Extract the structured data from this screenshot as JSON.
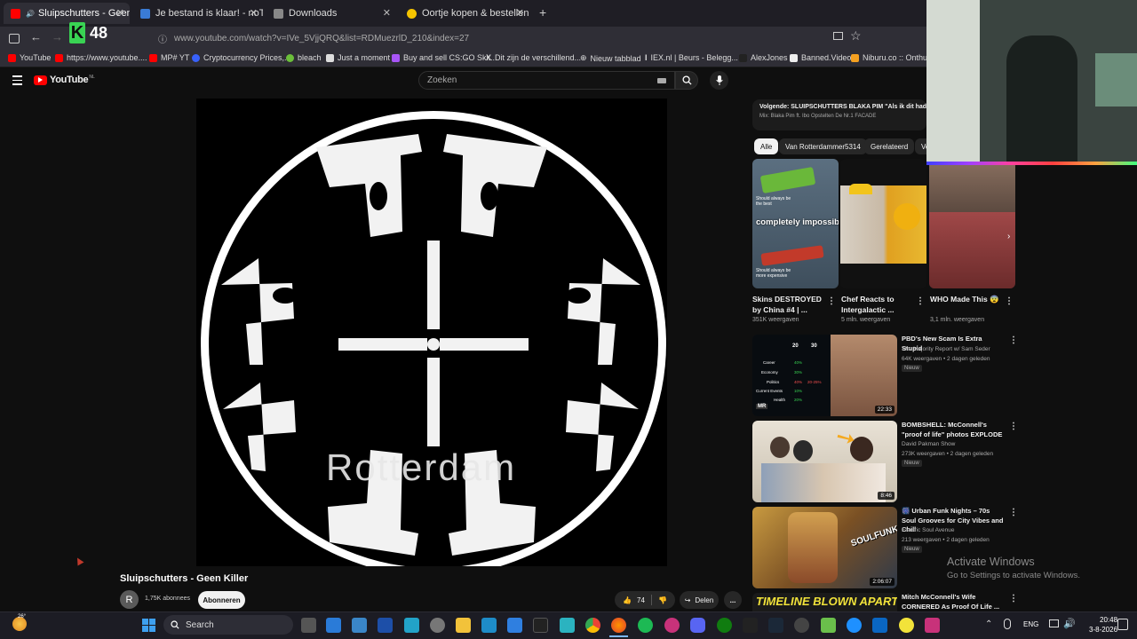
{
  "browser": {
    "tabs": [
      {
        "label": "Sluipschutters - Geen Killer",
        "active": true
      },
      {
        "label": "Je bestand is klaar! - noTube",
        "active": false
      },
      {
        "label": "Downloads",
        "active": false
      },
      {
        "label": "Oortje kopen & bestellen | Jum",
        "active": false
      }
    ],
    "new_tab": "+",
    "url": "www.youtube.com/watch?v=IVe_5VjjQRQ&list=RDMuezrlD_210&index=27",
    "overlay_logo_letter": "K",
    "overlay_count": "48",
    "bookmarks": [
      "YouTube",
      "https://www.youtube....",
      "MP# YT",
      "Cryptocurrency Prices,...",
      "bleach",
      "Just a moment",
      "Buy and sell CS:GO Ski...",
      "Dit zijn de verschillend...",
      "Nieuw tabblad",
      "IEX.nl | Beurs - Belegg...",
      "AlexJones",
      "Banned.Video",
      "Niburu.co :: Onthulle..."
    ]
  },
  "youtube": {
    "logo": "YouTube",
    "logo_region": "NL",
    "search_placeholder": "Zoeken",
    "video": {
      "overlay_text": "Rotterdam",
      "title": "Sluipschutters - Geen Killer",
      "channel_initial": "R",
      "subscribers": "1,75K abonnees",
      "subscribe_label": "Abonneren",
      "likes": "74",
      "share_label": "Delen",
      "more": "..."
    },
    "up_next": {
      "title": "Volgende: SLUIPSCHUTTERS BLAKA PIM \"Als ik dit had g",
      "subtitle": "Mix: Blaka Pim ft. Ibo Opstelten De Nr.1 FACADE"
    },
    "chips": [
      "Alle",
      "Van Rotterdammer5314",
      "Gerelateerd",
      "Vo"
    ],
    "shorts": [
      {
        "title": "Skins DESTROYED by China #4 | ...",
        "views": "351K weergaven",
        "overlay": "completely impossible",
        "top_note": "Should always be the best",
        "bottom_note": "Should always be more expensive"
      },
      {
        "title": "Chef Reacts to Intergalactic ...",
        "views": "5 mln. weergaven"
      },
      {
        "title": "WHO Made This 😨",
        "views": "3,1 mln. weergaven"
      }
    ],
    "recommended": [
      {
        "title": "PBD's New Scam Is Extra Stupid",
        "channel": "The Majority Report w/ Sam Seder",
        "meta": "64K weergaven • 2 dagen geleden",
        "badge": "Nieuw",
        "duration": "22:33"
      },
      {
        "title": "BOMBSHELL: McConnell's \"proof of life\" photos EXPLODE",
        "channel": "David Pakman Show",
        "meta": "273K weergaven • 2 dagen geleden",
        "badge": "Nieuw",
        "duration": "8:46"
      },
      {
        "title": "🎆 Urban Funk Nights – 70s Soul Grooves for City Vibes and Chill",
        "channel": "Electric Soul Avenue",
        "meta": "213 weergaven • 2 dagen geleden",
        "badge": "Nieuw",
        "duration": "2:06:07",
        "thumb_text": "SOULFUNK"
      },
      {
        "title": "Mitch McConnell's Wife CORNERED As Proof Of Life ...",
        "thumb_text": "TIMELINE BLOWN APART"
      }
    ],
    "pbd_table": {
      "headers": [
        "20",
        "30"
      ],
      "rows": [
        {
          "label": "Career",
          "a": "40%"
        },
        {
          "label": "Economy",
          "a": "30%"
        },
        {
          "label": "Politics",
          "a": "40%",
          "b": "20-25%"
        },
        {
          "label": "Current Events",
          "a": "10%"
        },
        {
          "label": "Health",
          "a": "20%"
        }
      ],
      "logo": "MR"
    }
  },
  "windows": {
    "activate_title": "Activate Windows",
    "activate_sub": "Go to Settings to activate Windows.",
    "weather_temp": "26°",
    "search_label": "Search",
    "lang": "ENG",
    "time": "20:48",
    "date": "3-8-2026"
  },
  "colors": {
    "yt_red": "#ff0000",
    "bg": "#0f0f0f",
    "accent_ticker": "#39d353"
  }
}
